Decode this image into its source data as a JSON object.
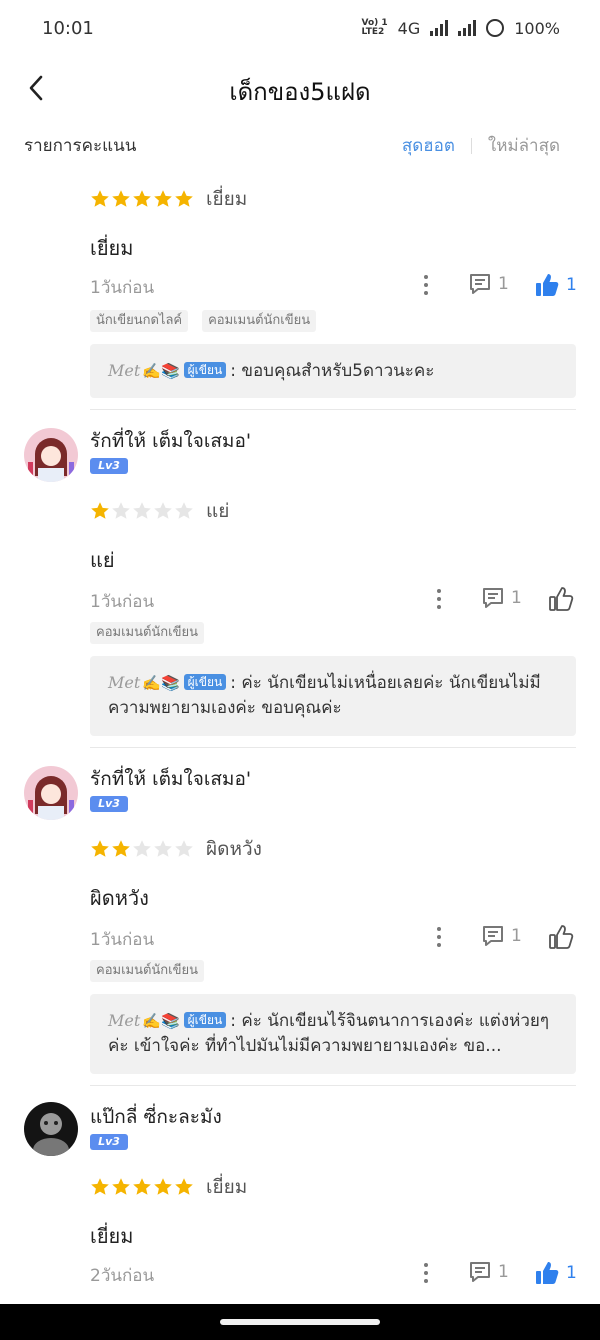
{
  "status_bar": {
    "time": "10:01",
    "volte_top": "Vo) 1",
    "volte_bottom": "LTE2",
    "network": "4G",
    "battery": "100%"
  },
  "header": {
    "title": "เด็กของ5แฝด"
  },
  "filter": {
    "label": "รายการคะแนน",
    "tab_hot": "สุดฮอต",
    "tab_new": "ใหม่ล่าสุด"
  },
  "reviews": [
    {
      "stars": 5,
      "rating_word": "เยี่ยม",
      "text": "เยี่ยม",
      "time": "1วันก่อน",
      "comment_count": "1",
      "like_count": "1",
      "tags": [
        "นักเขียนกดไลค์",
        "คอมเมนต์นักเขียน"
      ],
      "reply": {
        "author": "Met",
        "emoji": "✍️📚",
        "badge": "ผู้เขียน",
        "text": ": ขอบคุณสำหรับ5ดาวนะคะ"
      }
    },
    {
      "username": "รักที่ให้ เต็มใจเสมอ'",
      "level": "Lv3",
      "stars": 1,
      "rating_word": "แย่",
      "text": "แย่",
      "time": "1วันก่อน",
      "comment_count": "1",
      "tags": [
        "คอมเมนต์นักเขียน"
      ],
      "reply": {
        "author": "Met",
        "emoji": "✍️📚",
        "badge": "ผู้เขียน",
        "text": ": ค่ะ นักเขียนไม่เหนื่อยเลยค่ะ นักเขียนไม่มีความพยายามเองค่ะ ขอบคุณค่ะ"
      }
    },
    {
      "username": "รักที่ให้ เต็มใจเสมอ'",
      "level": "Lv3",
      "stars": 2,
      "rating_word": "ผิดหวัง",
      "text": "ผิดหวัง",
      "time": "1วันก่อน",
      "comment_count": "1",
      "tags": [
        "คอมเมนต์นักเขียน"
      ],
      "reply": {
        "author": "Met",
        "emoji": "✍️📚",
        "badge": "ผู้เขียน",
        "text": ": ค่ะ นักเขียนไร้จินตนาการเองค่ะ แต่งห่วยๆค่ะ เข้าใจค่ะ ที่ทำไปมันไม่มีความพยายามเองค่ะ ขอ..."
      }
    },
    {
      "username": "แป๊กลี่ ซี่กะละมัง",
      "level": "Lv3",
      "stars": 5,
      "rating_word": "เยี่ยม",
      "text": "เยี่ยม",
      "time": "2วันก่อน",
      "comment_count": "1",
      "like_count": "1"
    }
  ],
  "colors": {
    "accent": "#4a90e2",
    "like_active": "#2f80ed",
    "star_on": "#f5b400",
    "star_off": "#e6e6e6"
  },
  "icons": {
    "back": "chevron-left-icon",
    "more": "more-vertical-icon",
    "comment": "comment-icon",
    "like": "thumbs-up-icon",
    "star": "star-icon"
  }
}
